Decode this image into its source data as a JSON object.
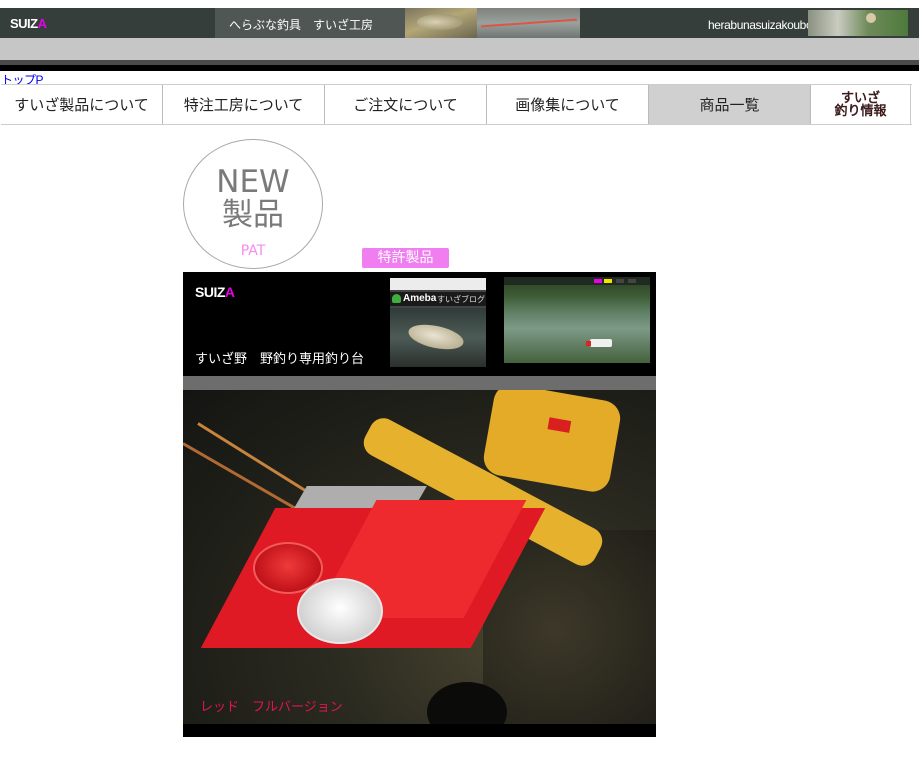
{
  "header": {
    "logo_main": "SUIZ",
    "logo_accent": "A",
    "tagline": "へらぶな釣具　すいざ工房",
    "site_name": "herabunasuizakoubou"
  },
  "top_link": "トップP",
  "nav": {
    "items": [
      {
        "label": "すいざ製品について"
      },
      {
        "label": "特注工房について"
      },
      {
        "label": "ご注文について"
      },
      {
        "label": "画像集について"
      },
      {
        "label": "商品一覧"
      }
    ],
    "info_line1": "すいざ",
    "info_line2": "釣り情報"
  },
  "badge": {
    "line1": "NEW",
    "line2": "製品",
    "line3": "PAT"
  },
  "patent_label": "特許製品",
  "panel": {
    "logo_main": "SUIZ",
    "logo_accent": "A",
    "caption": "すいざ野　野釣り専用釣り台",
    "blog_label": "Ameba",
    "blog_name": "すいざブログ",
    "photo_caption": "レッド　フルバージョン"
  },
  "colors": {
    "accent_magenta": "#e800e8",
    "patent_pink": "#f07ef0",
    "caption_red": "#e4154f"
  }
}
